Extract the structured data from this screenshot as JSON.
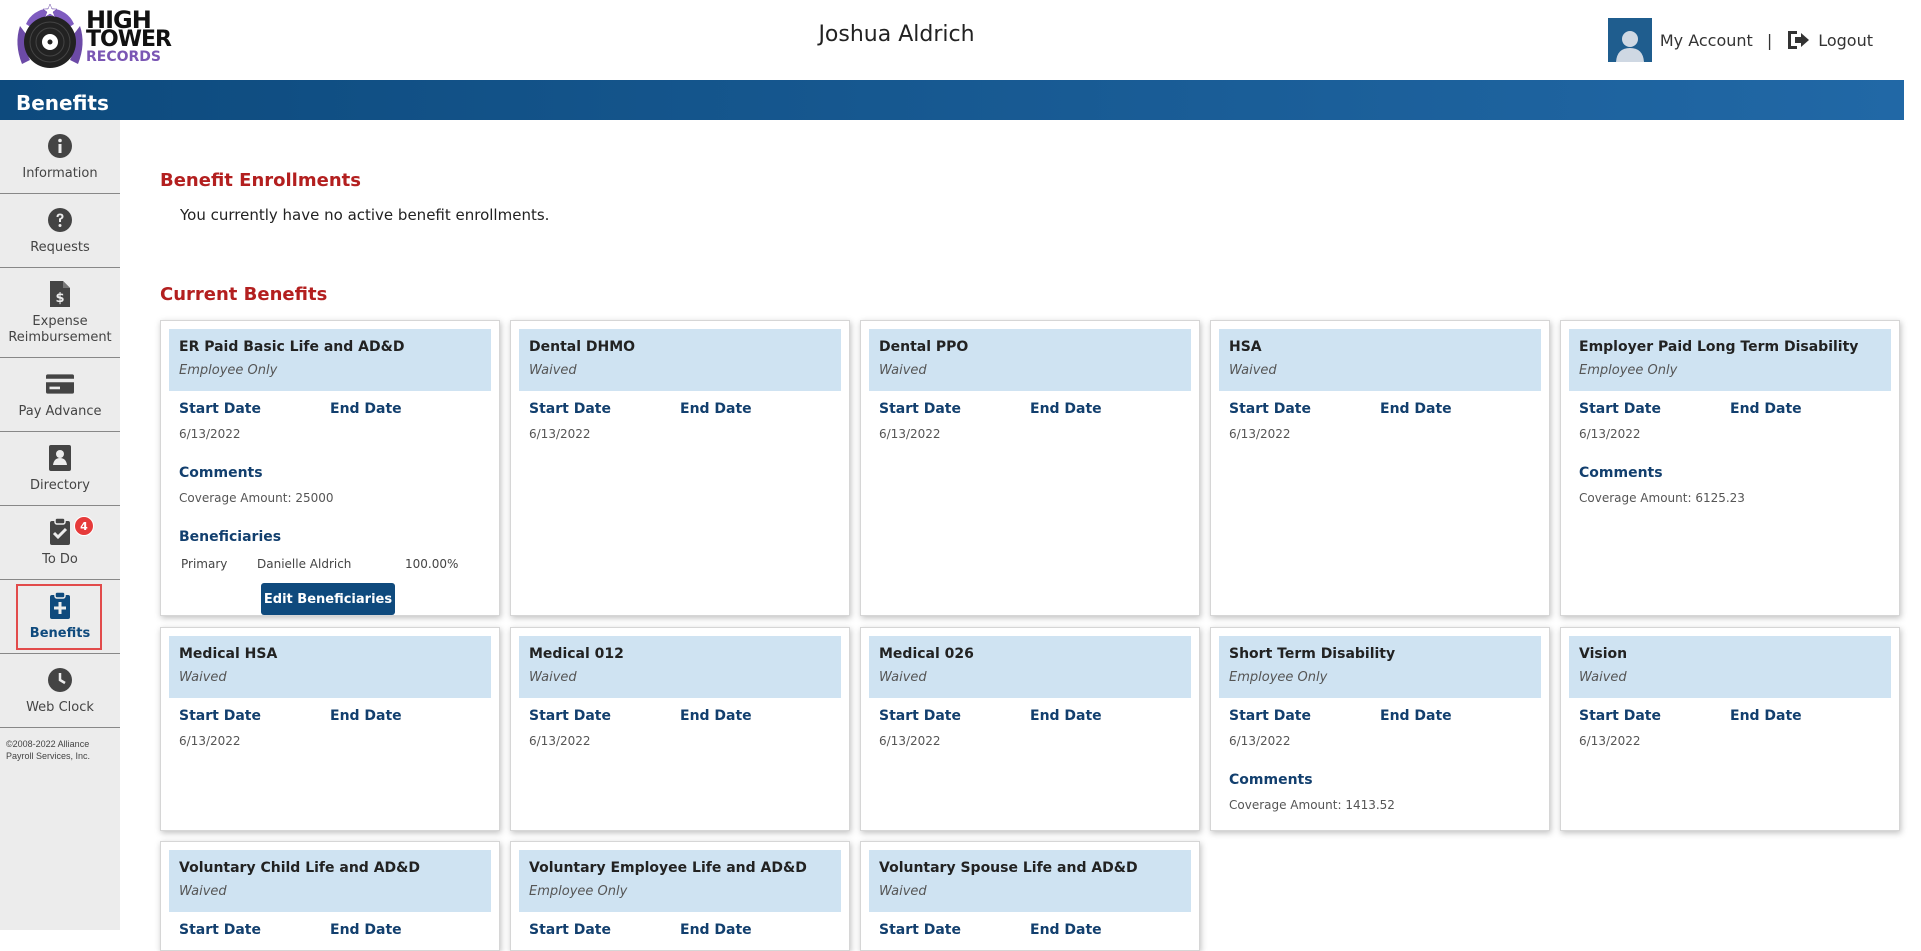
{
  "header": {
    "logo": {
      "line1": "HIGH",
      "line2": "TOWER",
      "line3": "RECORDS"
    },
    "user_name": "Joshua Aldrich",
    "my_account": "My Account",
    "separator": "|",
    "logout": "Logout"
  },
  "title_bar": {
    "title": "Benefits"
  },
  "sidebar": {
    "items": [
      {
        "label": "Information",
        "icon": "info-icon"
      },
      {
        "label": "Requests",
        "icon": "question-icon"
      },
      {
        "label": "Expense Reimbursement",
        "icon": "receipt-icon"
      },
      {
        "label": "Pay Advance",
        "icon": "card-icon"
      },
      {
        "label": "Directory",
        "icon": "contact-book-icon"
      },
      {
        "label": "To Do",
        "icon": "clipboard-check-icon",
        "badge": "4"
      },
      {
        "label": "Benefits",
        "icon": "clipboard-plus-icon",
        "active": true
      },
      {
        "label": "Web Clock",
        "icon": "clock-icon"
      }
    ],
    "copyright": "©2008-2022 Alliance Payroll Services, Inc."
  },
  "enrollments": {
    "title": "Benefit Enrollments",
    "note": "You currently have no active benefit enrollments."
  },
  "current_benefits": {
    "title": "Current Benefits",
    "start_label": "Start Date",
    "end_label": "End Date",
    "comments_label": "Comments",
    "beneficiaries_label": "Beneficiaries",
    "edit_beneficiaries_label": "Edit Beneficiaries",
    "cards": [
      {
        "title": "ER Paid Basic Life and AD&D",
        "status": "Employee Only",
        "start": "6/13/2022",
        "end": "",
        "comments": "Coverage Amount: 25000",
        "beneficiaries": [
          {
            "type": "Primary",
            "name": "Danielle Aldrich",
            "pct": "100.00%"
          }
        ]
      },
      {
        "title": "Dental DHMO",
        "status": "Waived",
        "start": "6/13/2022",
        "end": ""
      },
      {
        "title": "Dental PPO",
        "status": "Waived",
        "start": "6/13/2022",
        "end": ""
      },
      {
        "title": "HSA",
        "status": "Waived",
        "start": "6/13/2022",
        "end": ""
      },
      {
        "title": "Employer Paid Long Term Disability",
        "status": "Employee Only",
        "start": "6/13/2022",
        "end": "",
        "comments": "Coverage Amount: 6125.23"
      },
      {
        "title": "Medical HSA",
        "status": "Waived",
        "start": "6/13/2022",
        "end": ""
      },
      {
        "title": "Medical 012",
        "status": "Waived",
        "start": "6/13/2022",
        "end": ""
      },
      {
        "title": "Medical 026",
        "status": "Waived",
        "start": "6/13/2022",
        "end": ""
      },
      {
        "title": "Short Term Disability",
        "status": "Employee Only",
        "start": "6/13/2022",
        "end": "",
        "comments": "Coverage Amount: 1413.52"
      },
      {
        "title": "Vision",
        "status": "Waived",
        "start": "6/13/2022",
        "end": ""
      },
      {
        "title": "Voluntary Child Life and AD&D",
        "status": "Waived",
        "start": "",
        "end": ""
      },
      {
        "title": "Voluntary Employee Life and AD&D",
        "status": "Employee Only",
        "start": "",
        "end": ""
      },
      {
        "title": "Voluntary Spouse Life and AD&D",
        "status": "Waived",
        "start": "",
        "end": ""
      }
    ]
  }
}
